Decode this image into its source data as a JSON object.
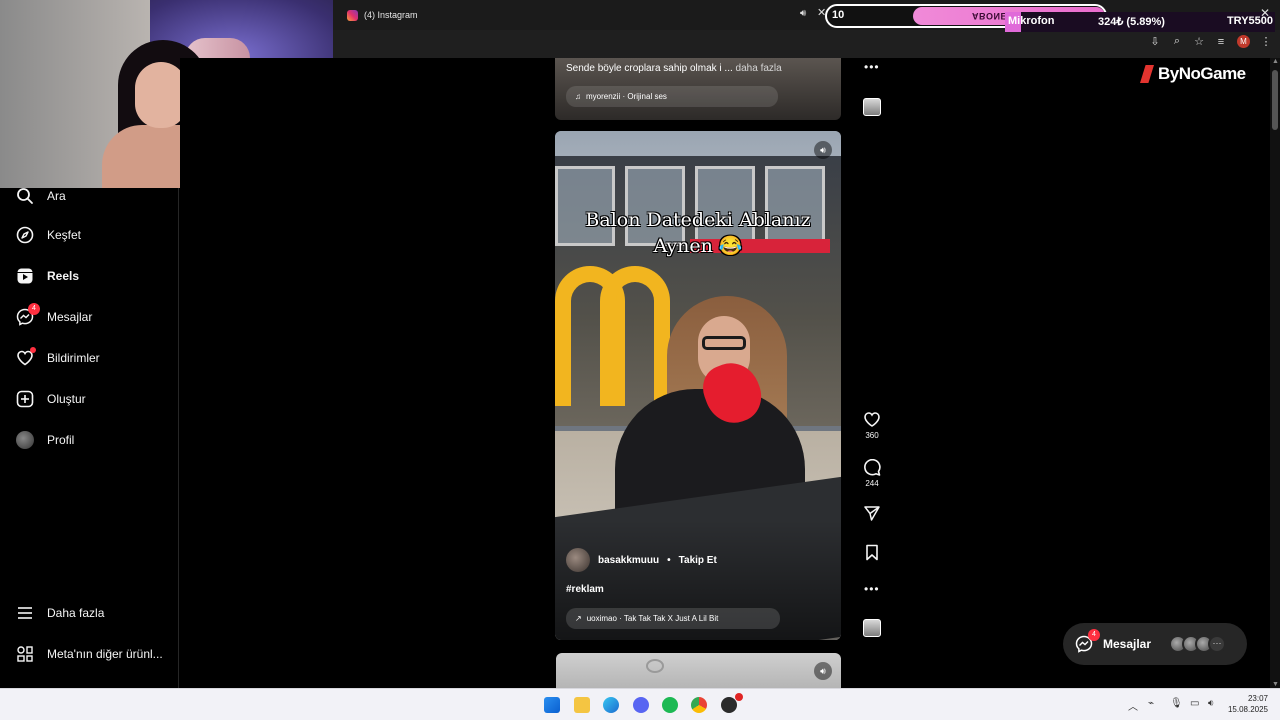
{
  "browser": {
    "tab_title": "(4) Instagram",
    "tab_audio_icon": "speaker-icon",
    "tab_close_icon": "close-icon",
    "toolbar_icons": [
      "download-icon",
      "zoom-icon",
      "star-icon",
      "media-icon",
      "profile-icon",
      "menu-icon"
    ],
    "profile_initial": "M"
  },
  "stream_overlay": {
    "count": "10",
    "goal_label": "ABONE HEDEFİ",
    "donation_label": "Mikrofon",
    "donation_amount": "324₺ (5.89%)",
    "donation_target": "TRY5500",
    "donation_progress": 0.0589
  },
  "sidebar": {
    "items": [
      {
        "label": "Ara",
        "icon": "search-icon"
      },
      {
        "label": "Keşfet",
        "icon": "compass-icon"
      },
      {
        "label": "Reels",
        "icon": "reels-icon",
        "active": true
      },
      {
        "label": "Mesajlar",
        "icon": "messenger-icon",
        "badge": "4"
      },
      {
        "label": "Bildirimler",
        "icon": "heart-icon",
        "dot": true
      },
      {
        "label": "Oluştur",
        "icon": "plus-square-icon"
      },
      {
        "label": "Profil",
        "icon": "avatar"
      }
    ],
    "bottom": [
      {
        "label": "Daha fazla",
        "icon": "hamburger-icon"
      },
      {
        "label": "Meta'nın diğer ürünl...",
        "icon": "meta-apps-icon"
      }
    ]
  },
  "previous_reel": {
    "caption": "Sende böyle croplara sahip olmak i ...",
    "more": "daha fazla",
    "audio": "myorenzii · Orijinal ses"
  },
  "reel": {
    "overlay_text_line1": "Balon Datedeki  Ablanız",
    "overlay_text_line2": "Aynen 😂",
    "username": "basakkmuuu",
    "separator": "•",
    "follow": "Takip Et",
    "caption": "#reklam",
    "audio": "uoximao · Tak Tak Tak X Just A Lil Bit",
    "likes": "360",
    "comments": "244"
  },
  "brand": "ByNoGame",
  "messages_pill": {
    "label": "Mesajlar",
    "badge": "4",
    "more": "···"
  },
  "taskbar": {
    "time": "23:07",
    "date": "15.08.2025",
    "apps": [
      "windows-start-icon",
      "folder-icon",
      "edge-icon",
      "discord-icon",
      "spotify-icon",
      "chrome-icon",
      "obs-icon"
    ]
  },
  "colors": {
    "accent_pink": "#e06ad9",
    "badge_red": "#ff3040",
    "mcdonalds_yellow": "#f2b51f"
  }
}
